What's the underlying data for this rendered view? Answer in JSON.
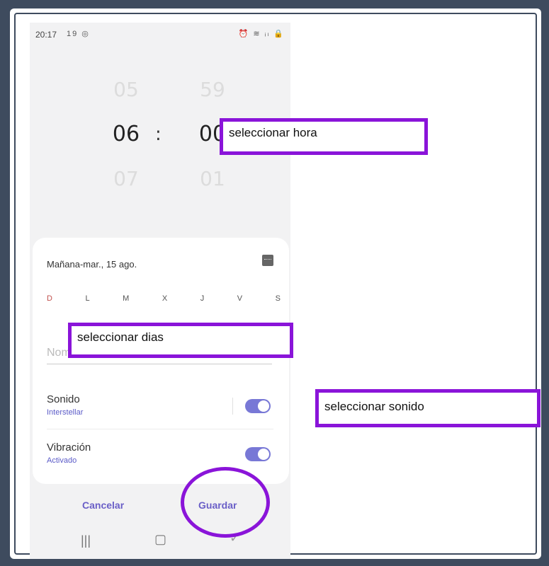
{
  "status_bar": {
    "time": "20:17",
    "left_icons": "19 ◎",
    "right_icons": "⏰ ≋ ᵢₗ 🔒"
  },
  "time_picker": {
    "hour_prev": "05",
    "hour_selected": "06",
    "hour_next": "07",
    "minute_prev": "59",
    "minute_selected": "00",
    "minute_next": "01",
    "separator": ":"
  },
  "alarm_card": {
    "date_label": "Mañana-mar., 15 ago.",
    "days": [
      "D",
      "L",
      "M",
      "X",
      "J",
      "V",
      "S"
    ],
    "name_placeholder": "Nombre de alarma",
    "sound": {
      "title": "Sonido",
      "value": "Interstellar",
      "enabled": true
    },
    "vibration": {
      "title": "Vibración",
      "value": "Activado",
      "enabled": true
    }
  },
  "actions": {
    "cancel_label": "Cancelar",
    "save_label": "Guardar"
  },
  "annotations": {
    "hour_label": "seleccionar hora",
    "days_label": "seleccionar dias",
    "sound_label": "seleccionar sonido",
    "color": "#8a14d9"
  },
  "colors": {
    "accent": "#6a5fc7",
    "toggle": "#7878d6",
    "background": "#3e4b5e"
  }
}
